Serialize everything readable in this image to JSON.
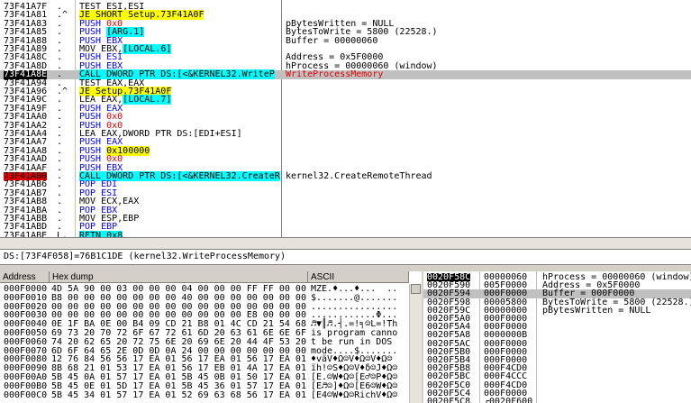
{
  "cpu": {
    "rows": [
      {
        "addr": "73F41A7F",
        "gut": " .",
        "ins": "TEST ESI,ESI",
        "com": "",
        "style": ""
      },
      {
        "addr": "73F41A81",
        "gut": " .^",
        "ins": "JE SHORT Setup.73F41A0F",
        "com": "",
        "style": "je"
      },
      {
        "addr": "73F41A83",
        "gut": " .",
        "ins": "PUSH 0x0",
        "com": "pBytesWritten = NULL",
        "style": "push-blue"
      },
      {
        "addr": "73F41A85",
        "gut": " .",
        "ins": "PUSH [ARG.1]",
        "com": "BytesToWrite = 5800 (22528.)",
        "style": "push-arg"
      },
      {
        "addr": "73F41A88",
        "gut": " .",
        "ins": "PUSH EBX",
        "com": "Buffer = 00000060",
        "style": ""
      },
      {
        "addr": "73F41A89",
        "gut": " .",
        "ins": "MOV EBX,[LOCAL.6]",
        "com": "",
        "style": "mov-local"
      },
      {
        "addr": "73F41A8C",
        "gut": " .",
        "ins": "PUSH ESI",
        "com": "Address = 0x5F0000",
        "style": ""
      },
      {
        "addr": "73F41A8D",
        "gut": " .",
        "ins": "PUSH EBX",
        "com": "hProcess = 00000060 (window)",
        "style": ""
      },
      {
        "addr": "73F41A8E",
        "gut": " .",
        "ins": "CALL DWORD PTR DS:[<&KERNEL32.WriteP",
        "com": "WriteProcessMemory",
        "style": "call-sel"
      },
      {
        "addr": "73F41A94",
        "gut": " .",
        "ins": "TEST EAX,EAX",
        "com": "",
        "style": ""
      },
      {
        "addr": "73F41A96",
        "gut": " .^",
        "ins": "JE Setup.73F41A0F",
        "com": "",
        "style": "je"
      },
      {
        "addr": "73F41A9C",
        "gut": " .",
        "ins": "LEA EAX,[LOCAL.7]",
        "com": "",
        "style": "lea-local"
      },
      {
        "addr": "73F41A9F",
        "gut": " .",
        "ins": "PUSH EAX",
        "com": "",
        "style": ""
      },
      {
        "addr": "73F41AA0",
        "gut": " .",
        "ins": "PUSH 0x0",
        "com": "",
        "style": "push-red"
      },
      {
        "addr": "73F41AA2",
        "gut": " .",
        "ins": "PUSH 0x0",
        "com": "",
        "style": "push-red"
      },
      {
        "addr": "73F41AA4",
        "gut": " .",
        "ins": "LEA EAX,DWORD PTR DS:[EDI+ESI]",
        "com": "",
        "style": ""
      },
      {
        "addr": "73F41AA7",
        "gut": " .",
        "ins": "PUSH EAX",
        "com": "",
        "style": ""
      },
      {
        "addr": "73F41AA8",
        "gut": " .",
        "ins": "PUSH 0x100000",
        "com": "",
        "style": "push-yel"
      },
      {
        "addr": "73F41AAD",
        "gut": " .",
        "ins": "PUSH 0x0",
        "com": "",
        "style": "push-red"
      },
      {
        "addr": "73F41AAF",
        "gut": " .",
        "ins": "PUSH EBX",
        "com": "",
        "style": ""
      },
      {
        "addr": "73F41AB0",
        "gut": " .",
        "ins": "CALL DWORD PTR DS:[<&KERNEL32.CreateR",
        "com": "kernel32.CreateRemoteThread",
        "style": "call-red"
      },
      {
        "addr": "73F41AB6",
        "gut": " .",
        "ins": "POP EDI",
        "com": "",
        "style": ""
      },
      {
        "addr": "73F41AB7",
        "gut": " .",
        "ins": "POP ESI",
        "com": "",
        "style": ""
      },
      {
        "addr": "73F41AB8",
        "gut": " .",
        "ins": "MOV ECX,EAX",
        "com": "",
        "style": ""
      },
      {
        "addr": "73F41ABA",
        "gut": " .",
        "ins": "POP EBX",
        "com": "",
        "style": ""
      },
      {
        "addr": "73F41ABB",
        "gut": " .",
        "ins": "MOV ESP,EBP",
        "com": "",
        "style": ""
      },
      {
        "addr": "73F41ABD",
        "gut": " .",
        "ins": "POP EBP",
        "com": "",
        "style": ""
      },
      {
        "addr": "73F41ABE",
        "gut": " L.",
        "ins": "RETN 0x8",
        "com": "",
        "style": "retn"
      }
    ]
  },
  "info_line": "DS:[73F4F058]=76B1C1DE (kernel32.WriteProcessMemory)",
  "dump": {
    "headers": {
      "address": "Address",
      "hex": "Hex dump",
      "ascii": "ASCII"
    },
    "rows": [
      {
        "addr": "000F0000",
        "hex": "4D 5A 90 00 03 00 00 00 04 00 00 00 FF FF 00 00",
        "ascii": "MZE.♦...♦...  .."
      },
      {
        "addr": "000F0010",
        "hex": "B8 00 00 00 00 00 00 00 40 00 00 00 00 00 00 00",
        "ascii": "$.......@......."
      },
      {
        "addr": "000F0020",
        "hex": "00 00 00 00 00 00 00 00 00 00 00 00 00 00 00 00",
        "ascii": "................"
      },
      {
        "addr": "000F0030",
        "hex": "00 00 00 00 00 00 00 00 00 00 00 00 E8 00 00 00",
        "ascii": "............Φ..."
      },
      {
        "addr": "000F0040",
        "hex": "0E 1F BA 0E 00 B4 09 CD 21 B8 01 4C CD 21 54 68",
        "ascii": "♬▼║♬.┤.=!╕☺L=!Th"
      },
      {
        "addr": "000F0050",
        "hex": "69 73 20 70 72 6F 67 72 61 6D 20 63 61 6E 6E 6F",
        "ascii": "is program canno"
      },
      {
        "addr": "000F0060",
        "hex": "74 20 62 65 20 72 75 6E 20 69 6E 20 44 4F 53 20",
        "ascii": "t be run in DOS "
      },
      {
        "addr": "000F0070",
        "hex": "6D 6F 64 65 2E 0D 0D 0A 24 00 00 00 00 00 00 00",
        "ascii": "mode....$......."
      },
      {
        "addr": "000F0080",
        "hex": "12 76 84 56 56 17 EA 01 56 17 EA 01 56 17 EA 01",
        "ascii": "♦väV♦Ω☺V♦Ω☺V♦Ω☺"
      },
      {
        "addr": "000F0090",
        "hex": "8B 68 21 01 53 17 EA 01 56 17 EB 01 4A 17 EA 01",
        "ascii": "ïh!☺S♦Ω☺V♦δ☺J♦Ω☺"
      },
      {
        "addr": "000F00A0",
        "hex": "5B 45 0A 01 57 17 EA 01 5B 45 0B 01 50 17 EA 01",
        "ascii": "[E.☺W♦Ω☺[E♂☺P♦Ω☺"
      },
      {
        "addr": "000F00B0",
        "hex": "5B 45 0E 01 5D 17 EA 01 5B 45 36 01 57 17 EA 01",
        "ascii": "[E♬☺]♦Ω☺[E6☺W♦Ω☺"
      },
      {
        "addr": "000F00C0",
        "hex": "5B 45 34 01 57 17 EA 01 52 69 63 68 56 17 EA 01",
        "ascii": "[E4☺W♦Ω☺RichV♦Ω☺"
      }
    ]
  },
  "stack": {
    "rows": [
      {
        "addr": "0020F58C",
        "val": "00000060",
        "com": "hProcess = 00000060 (window)",
        "style": "bp"
      },
      {
        "addr": "0020F590",
        "val": "005F0000",
        "com": "Address = 0x5F0000",
        "style": ""
      },
      {
        "addr": "0020F594",
        "val": "000F0000",
        "com": "Buffer = 000F0000",
        "style": "sel"
      },
      {
        "addr": "0020F598",
        "val": "00005800",
        "com": "BytesToWrite = 5800 (22528.)",
        "style": ""
      },
      {
        "addr": "0020F59C",
        "val": "00000000",
        "com": "pBytesWritten = NULL",
        "style": ""
      },
      {
        "addr": "0020F5A0",
        "val": "000F0000",
        "com": "",
        "style": ""
      },
      {
        "addr": "0020F5A4",
        "val": "000F0000",
        "com": "",
        "style": ""
      },
      {
        "addr": "0020F5A8",
        "val": "0000000B",
        "com": "",
        "style": ""
      },
      {
        "addr": "0020F5AC",
        "val": "000F0000",
        "com": "",
        "style": ""
      },
      {
        "addr": "0020F5B0",
        "val": "000F0000",
        "com": "",
        "style": ""
      },
      {
        "addr": "0020F5B4",
        "val": "000F0000",
        "com": "",
        "style": ""
      },
      {
        "addr": "0020F5B8",
        "val": "000F4CD0",
        "com": "",
        "style": ""
      },
      {
        "addr": "0020F5BC",
        "val": "000F4CCC",
        "com": "",
        "style": ""
      },
      {
        "addr": "0020F5C0",
        "val": "000F4CD0",
        "com": "",
        "style": ""
      },
      {
        "addr": "0020F5C4",
        "val": "000F0000",
        "com": "",
        "style": ""
      },
      {
        "addr": "0020F5C8",
        "val": "┌0020F600",
        "com": "",
        "style": ""
      }
    ]
  }
}
